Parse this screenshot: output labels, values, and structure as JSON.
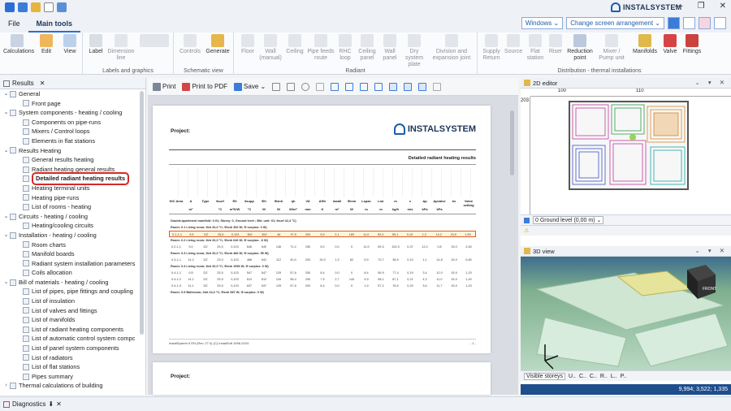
{
  "app": {
    "brand": "INSTALSYSTEM",
    "window_controls": [
      "—",
      "❐",
      "✕"
    ]
  },
  "tabs": [
    {
      "label": "File"
    },
    {
      "label": "Main tools"
    }
  ],
  "toolbar_right": {
    "windows_dropdown": "Windows ⌄",
    "arrangement_dropdown": "Change screen arrangement ⌄"
  },
  "ribbon": {
    "groups": [
      {
        "label": "",
        "buttons": [
          "Calculations",
          "Edit",
          "View"
        ]
      },
      {
        "label": "Labels and graphics",
        "buttons": [
          "Label",
          "Dimension line",
          "",
          ""
        ]
      },
      {
        "label": "Schematic view",
        "buttons": [
          "Controls",
          "Generate"
        ]
      },
      {
        "label": "Radiant",
        "buttons": [
          "Floor",
          "Wall (manual)",
          "Ceiling",
          "Pipe feeds route",
          "RHC loop",
          "Ceiling panel",
          "Wall panel",
          "Dry system plate",
          "Division and expansion joint"
        ]
      },
      {
        "label": "Distribution - thermal installations",
        "buttons": [
          "Supply Return",
          "Source",
          "Flat station",
          "Riser",
          "Reduction point",
          "Mixer / Pump unit",
          "Manifolds",
          "Valve",
          "Fittings"
        ]
      }
    ]
  },
  "left_panel": {
    "title": "Results",
    "tree": [
      {
        "level": 1,
        "label": "General",
        "expanded": true
      },
      {
        "level": 2,
        "label": "Front page"
      },
      {
        "level": 1,
        "label": "System components - heating / cooling",
        "expanded": true
      },
      {
        "level": 2,
        "label": "Components on pipe-runs"
      },
      {
        "level": 2,
        "label": "Mixers / Control loops"
      },
      {
        "level": 2,
        "label": "Elements in flat stations"
      },
      {
        "level": 1,
        "label": "Results Heating",
        "expanded": true
      },
      {
        "level": 2,
        "label": "General results heating"
      },
      {
        "level": 2,
        "label": "Radiant heating general results"
      },
      {
        "level": 2,
        "label": "Detailed radiant heating results",
        "selected": true
      },
      {
        "level": 2,
        "label": "Heating terminal units"
      },
      {
        "level": 2,
        "label": "Heating pipe-runs"
      },
      {
        "level": 2,
        "label": "List of rooms - heating"
      },
      {
        "level": 1,
        "label": "Circuits - heating / cooling",
        "expanded": true
      },
      {
        "level": 2,
        "label": "Heating/cooling circuits"
      },
      {
        "level": 1,
        "label": "Installation - heating / cooling",
        "expanded": true
      },
      {
        "level": 2,
        "label": "Room charts"
      },
      {
        "level": 2,
        "label": "Manifold boards"
      },
      {
        "level": 2,
        "label": "Radiant system installation parameters"
      },
      {
        "level": 2,
        "label": "Coils allocation"
      },
      {
        "level": 1,
        "label": "Bill of materials - heating / cooling",
        "expanded": true
      },
      {
        "level": 2,
        "label": "List of pipes, pipe fittings and coupling"
      },
      {
        "level": 2,
        "label": "List of insulation"
      },
      {
        "level": 2,
        "label": "List of valves and fittings"
      },
      {
        "level": 2,
        "label": "List of manifolds"
      },
      {
        "level": 2,
        "label": "List of radiant heating components"
      },
      {
        "level": 2,
        "label": "List of automatic control system compc"
      },
      {
        "level": 2,
        "label": "List of panel system components"
      },
      {
        "level": 2,
        "label": "List of radiators"
      },
      {
        "level": 2,
        "label": "List of flat stations"
      },
      {
        "level": 2,
        "label": "Pipes summary"
      },
      {
        "level": 1,
        "label": "Thermal calculations of building",
        "expanded": false
      }
    ]
  },
  "center_toolbar": {
    "print": "Print",
    "print_pdf": "Print to PDF",
    "save": "Save ⌄"
  },
  "document": {
    "project_label": "Project:",
    "logo_text": "INSTALSYSTEM",
    "table_title": "Detailed radiant heating results",
    "header_labels": [
      "H/C Area",
      "A",
      "Type",
      "θsurf",
      "Rλ",
      "θsupp",
      "Φh",
      "Φsnh",
      "qh",
      "VA",
      "ΔΦe",
      "Awall",
      "Φrem",
      "Lspac",
      "Lmr",
      "m",
      "v",
      "Δp",
      "Δpvalve",
      "kv",
      "Valve setting"
    ],
    "header_units": [
      "",
      "m²",
      "",
      "°C",
      "m²K/W",
      "°C",
      "W",
      "W",
      "W/m²",
      "mm",
      "K",
      "m²",
      "W",
      "m",
      "m",
      "kg/h",
      "m/s",
      "kPa",
      "kPa",
      "",
      ""
    ],
    "group_rows": [
      "Double-apartment manifold: 0.01; Storey: 0, Ground level ; Bld. unit: 01; θsurf 42,4 °C)",
      "Room: 0.1 Living room; θint 20,0 °C; Φsnh 352 W; Φ surplus: 0 W)",
      "Room: 0.2 Living room; θint 20,0 °C; Φsnh 646 W; Φ surplus: -6 W)",
      "Room: 0.3 Living room; θint 20,0 °C; Φsnh 486 W; Φ surplus: 55 W)",
      "Room: 0.4 Living room; θint 20,0 °C; Φsnh 1996 W; Φ surplus: 0 W)",
      "Room: 0.5 Bathroom; θint 24,0 °C; Φsnh 587 W; Φ surplus: 0 W)"
    ],
    "data_rows": [
      [
        "0.1-1-1",
        "9,5",
        "DZ",
        "25,5",
        "0,103",
        "352",
        "352",
        "46",
        "97,5",
        "200",
        "5,9",
        "2,1",
        "169",
        "11,0",
        "52,0",
        "59,1",
        "0,15",
        "1,2",
        "14,2",
        "15,9",
        "1,50"
      ],
      [
        "0.2-1-1",
        "9,0",
        "DZ",
        "25,5",
        "0,103",
        "646",
        "640",
        "146",
        "71,2",
        "150",
        "5,0",
        "0,0",
        "0",
        "11,9",
        "69,3",
        "152,3",
        "0,37",
        "13,2",
        "0,8",
        "15,0",
        "2,60"
      ],
      [
        "0.3-1-1",
        "14,2",
        "DZ",
        "23,9",
        "0,103",
        "486",
        "541",
        "112",
        "40,0",
        "200",
        "15,0",
        "1,3",
        "82",
        "5,9",
        "70,7",
        "38,9",
        "0,10",
        "1,1",
        "14,8",
        "15,9",
        "0,80"
      ],
      [
        "0.4-1-1",
        "9,5",
        "DZ",
        "25,5",
        "0,103",
        "547",
        "547",
        "129",
        "57,6",
        "200",
        "8,4",
        "0,0",
        "0",
        "8,4",
        "56,9",
        "77,4",
        "0,19",
        "3,4",
        "12,0",
        "15,9",
        "1,20"
      ],
      [
        "0.4-1-2",
        "14,1",
        "DZ",
        "25,5",
        "0,103",
        "612",
        "612",
        "134",
        "58,4",
        "200",
        "7,9",
        "2,7",
        "144",
        "9,9",
        "58,1",
        "87,1",
        "0,21",
        "4,3",
        "11,0",
        "15,9",
        "1,40"
      ],
      [
        "0.4-1-3",
        "11,1",
        "DZ",
        "25,5",
        "0,103",
        "637",
        "637",
        "129",
        "57,6",
        "200",
        "8,4",
        "0,0",
        "0",
        "1,9",
        "57,2",
        "78,9",
        "0,20",
        "3,6",
        "11,7",
        "15,9",
        "1,20"
      ]
    ],
    "footer_left": "InstalSystem 5 EN (Rev. 27.0) (C) InstalSoft 1996-2024",
    "footer_right": "- 1 -",
    "page2_project": "Project:"
  },
  "editor2d": {
    "title": "2D editor",
    "ruler_top": [
      "100",
      "110"
    ],
    "ruler_left": "203",
    "storey": "0 Ground  level (0,00 m) ⌄"
  },
  "view3d": {
    "title": "3D view",
    "cube_label": "FRONT",
    "visible_storeys": "Visible storeys",
    "filters": [
      "U..",
      "C..",
      "C..",
      "R..",
      "L..",
      "P.."
    ]
  },
  "statusbar": {
    "coords": "9,994; 3,522; 1,335"
  },
  "diagnostics": {
    "label": "Diagnostics"
  },
  "colors": {
    "accent": "#2a6fd6",
    "brand": "#1d3557",
    "selection_outline": "#d62828",
    "highlight_row": "#e05a2b"
  }
}
